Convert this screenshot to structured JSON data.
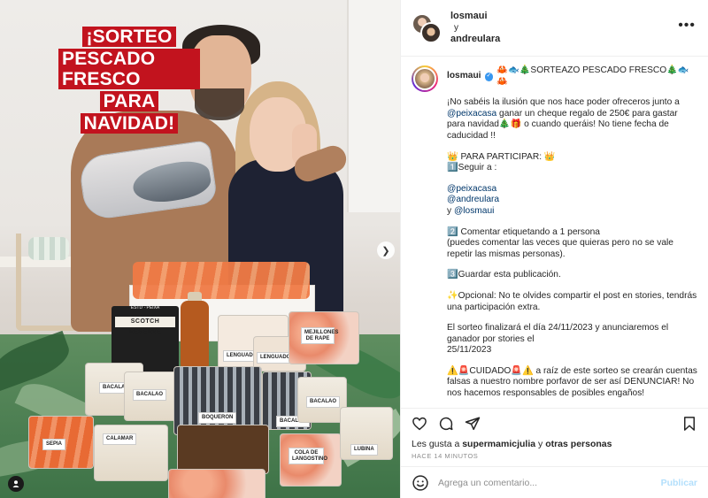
{
  "post_image": {
    "overlay_title_lines": [
      "¡SORTEO",
      "PESCADO FRESCO",
      "PARA",
      "NAVIDAD!"
    ],
    "overlay_color": "#c2131e",
    "product_labels": {
      "scotch": "SCOTCH RESERVE",
      "scotch_sub": "ESTD · PEIXA",
      "boqueron": "BOQUERON",
      "lenguado": "LENGUADO",
      "lenguado2": "LENGUADO",
      "bacalao1": "BACALAO",
      "bacalao2": "BACALAO",
      "bacalao3": "BACALAO",
      "bacalao4": "BACALAO",
      "calamar": "CALAMAR",
      "lubina": "LUBINA",
      "sepia": "SEPIA",
      "cola": "COLA DE LANGOSTINO",
      "mejillones": "MEJILLONES DE RAPE"
    },
    "next_icon": "chevron-right-icon",
    "tagged_icon": "user-tag-icon"
  },
  "header": {
    "user1": "losmaui",
    "separator": "y",
    "user2": "andreulara",
    "more_icon": "more-dots-icon"
  },
  "caption": {
    "username": "losmaui",
    "title": "🦀🐟🎄SORTEAZO PESCADO FRESCO🎄🐟🦀",
    "intro_a": "¡No sabéis la ilusión que nos hace poder ofreceros junto a ",
    "intro_mention": "@peixacasa",
    "intro_b": " ganar un cheque regalo de 250€ para gastar para navidad🎄🎁 o cuando queráis! No tiene fecha de caducidad !!",
    "participate": "👑 PARA PARTICIPAR: 👑",
    "step1": "1️⃣Seguir a :",
    "mention1": "@peixacasa",
    "mention2": "@andreulara",
    "and_word": "y ",
    "mention3": "@losmaui",
    "step2": "2️⃣ Comentar etiquetando a 1 persona",
    "step2_note": "(puedes comentar las veces que quieras pero no se vale repetir las mismas personas).",
    "step3": "3️⃣Guardar esta publicación.",
    "optional": "✨Opcional: No te olvides compartir el post en stories, tendrás una participación extra.",
    "end_a": "El sorteo finalizará el día 24/11/2023 y anunciaremos el ganador por stories el",
    "end_b": "25/11/2023",
    "warning": "⚠️🚨CUIDADO🚨⚠️ a raíz de este sorteo se crearán cuentas falsas a nuestro nombre porfavor de ser así DENUNCIAR! No nos hacemos responsables de posibles engaños!"
  },
  "actions": {
    "like_icon": "heart-icon",
    "comment_icon": "comment-icon",
    "share_icon": "share-icon",
    "save_icon": "bookmark-icon"
  },
  "likes": {
    "prefix": "Les gusta a ",
    "user": "supermamicjulia",
    "middle": " y ",
    "others": "otras personas"
  },
  "timestamp": "HACE 14 MINUTOS",
  "comment": {
    "emoji_icon": "emoji-icon",
    "placeholder": "Agrega un comentario...",
    "publish_label": "Publicar"
  }
}
